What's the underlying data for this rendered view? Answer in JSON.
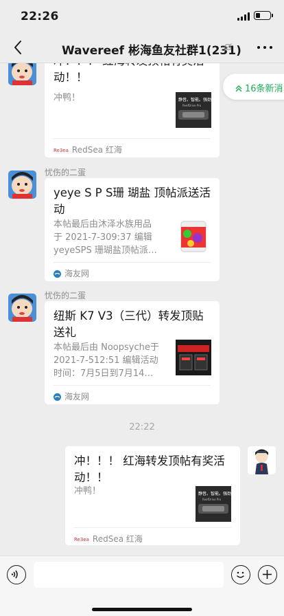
{
  "status": {
    "time": "22:26",
    "battery_level": 0.3
  },
  "nav": {
    "title": "Wavereef 彬海鱼友社群1(231)",
    "back_icon": "chevron-left-icon",
    "mute_icon": "bell-off-icon",
    "more_icon": "more-dots-icon"
  },
  "unread": {
    "label": "16条新消",
    "icon": "double-chevron-up-icon",
    "color": "#1aad52"
  },
  "messages": [
    {
      "sender": "",
      "card": {
        "title": "冲！！！ 红海转发顶帖有奖活动！！",
        "desc_lines": [
          "冲鸭！"
        ],
        "source": "RedSea 红海",
        "source_prefix": "Re3ea"
      }
    },
    {
      "sender": "忧伤的二蛋",
      "card": {
        "title": "yeye S P S珊 瑚盐 顶帖派送活动",
        "desc_lines": [
          "本帖最后由沐泽水族用品",
          "于 2021-7-309:37 编辑",
          "yeyeSPS 珊瑚盐顶帖派…"
        ],
        "source": "海友网"
      }
    },
    {
      "sender": "忧伤的二蛋",
      "card": {
        "title": "纽斯 K7 V3（三代）转发顶贴送礼",
        "desc_lines": [
          "本帖最后由 Noopsyche于",
          "2021-7-512:51 编辑活动",
          "时间：7月5日到7月14…"
        ],
        "source": "海友网"
      }
    },
    {
      "timestamp": "22:22"
    },
    {
      "sender": "",
      "card": {
        "title": "冲！！！ 红海转发顶帖有奖活动！！",
        "desc_lines": [
          "冲鸭！"
        ],
        "source": "RedSea 红海",
        "source_prefix": "Re3ea"
      }
    }
  ],
  "thumb_text": {
    "line1": "静音。智能。强劲。",
    "line2": "ReefDrive Pro"
  },
  "input": {
    "placeholder": "",
    "voice_icon": "voice-icon",
    "emoji_icon": "emoji-icon",
    "plus_icon": "plus-circle-icon"
  }
}
